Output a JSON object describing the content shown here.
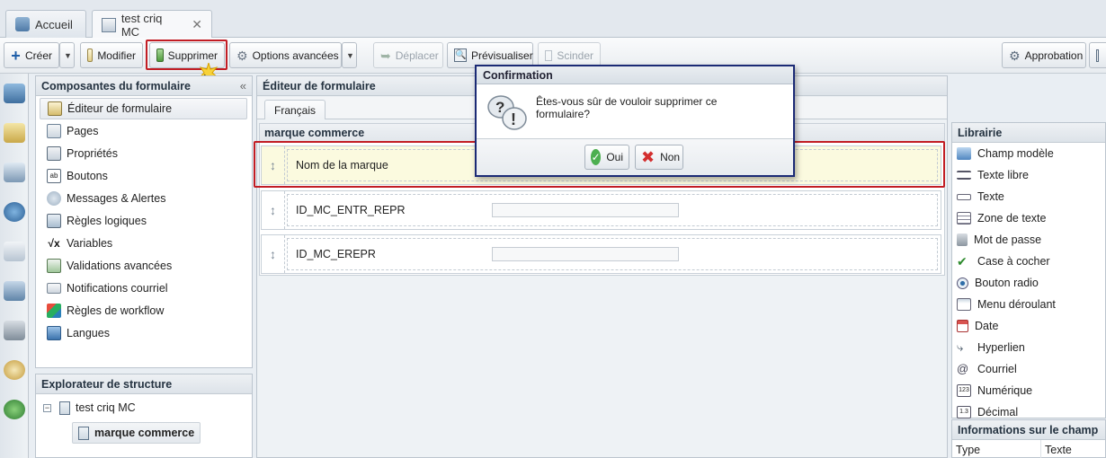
{
  "tabs": [
    {
      "label": "Accueil"
    },
    {
      "label": "test criq MC"
    }
  ],
  "toolbar": {
    "create": "Créer",
    "modify": "Modifier",
    "delete": "Supprimer",
    "advanced": "Options avancées",
    "move": "Déplacer",
    "preview": "Prévisualiser",
    "split": "Scinder",
    "approval": "Approbation"
  },
  "components": {
    "title": "Composantes du formulaire",
    "items": [
      "Éditeur de formulaire",
      "Pages",
      "Propriétés",
      "Boutons",
      "Messages & Alertes",
      "Règles logiques",
      "Variables",
      "Validations avancées",
      "Notifications courriel",
      "Règles de workflow",
      "Langues"
    ]
  },
  "explorer": {
    "title": "Explorateur de structure",
    "root": "test criq MC",
    "child": "marque commerce"
  },
  "editor": {
    "title": "Éditeur de formulaire",
    "lang_tab": "Français",
    "section": "marque commerce",
    "fields": [
      "Nom de la marque",
      "ID_MC_ENTR_REPR",
      "ID_MC_EREPR"
    ]
  },
  "library": {
    "title": "Librairie",
    "items": [
      "Champ modèle",
      "Texte libre",
      "Texte",
      "Zone de texte",
      "Mot de passe",
      "Case à cocher",
      "Bouton radio",
      "Menu déroulant",
      "Date",
      "Hyperlien",
      "Courriel",
      "Numérique",
      "Décimal"
    ]
  },
  "info": {
    "title": "Informations sur le champ",
    "rows": [
      {
        "key": "Type",
        "value": "Texte"
      }
    ]
  },
  "dialog": {
    "title": "Confirmation",
    "message": "Êtes-vous sûr de vouloir supprimer ce formulaire?",
    "yes": "Oui",
    "no": "Non"
  },
  "colors": {
    "highlight": "#c21d24",
    "dialog_border": "#1b2a75"
  }
}
